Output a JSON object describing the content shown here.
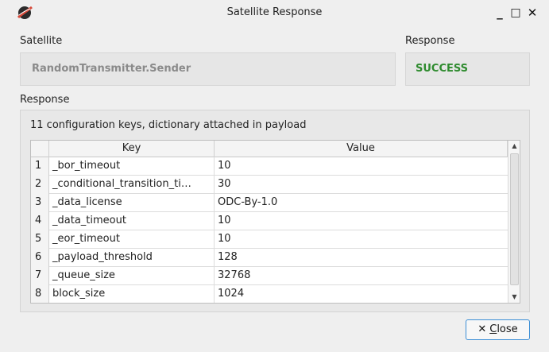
{
  "window": {
    "title": "Satellite Response",
    "minimize_glyph": "_",
    "maximize_glyph": "□",
    "close_glyph": "✕"
  },
  "satellite": {
    "label": "Satellite",
    "value": "RandomTransmitter.Sender"
  },
  "response": {
    "label": "Response",
    "value": "SUCCESS",
    "value_color": "#2e8b2e"
  },
  "response_group": {
    "label": "Response",
    "summary": "11 configuration keys, dictionary attached in payload"
  },
  "table": {
    "columns": [
      "Key",
      "Value"
    ],
    "rows": [
      {
        "n": "1",
        "key": "_bor_timeout",
        "value": "10"
      },
      {
        "n": "2",
        "key": "_conditional_transition_ti…",
        "value": "30"
      },
      {
        "n": "3",
        "key": "_data_license",
        "value": "ODC-By-1.0"
      },
      {
        "n": "4",
        "key": "_data_timeout",
        "value": "10"
      },
      {
        "n": "5",
        "key": "_eor_timeout",
        "value": "10"
      },
      {
        "n": "6",
        "key": "_payload_threshold",
        "value": "128"
      },
      {
        "n": "7",
        "key": "_queue_size",
        "value": "32768"
      },
      {
        "n": "8",
        "key": "block_size",
        "value": "1024"
      }
    ]
  },
  "buttons": {
    "close_icon_glyph": "✕",
    "close_mnemonic": "C",
    "close_rest": "lose"
  },
  "icons": {
    "app": "satellite-app-icon",
    "close": "close-x-icon"
  }
}
